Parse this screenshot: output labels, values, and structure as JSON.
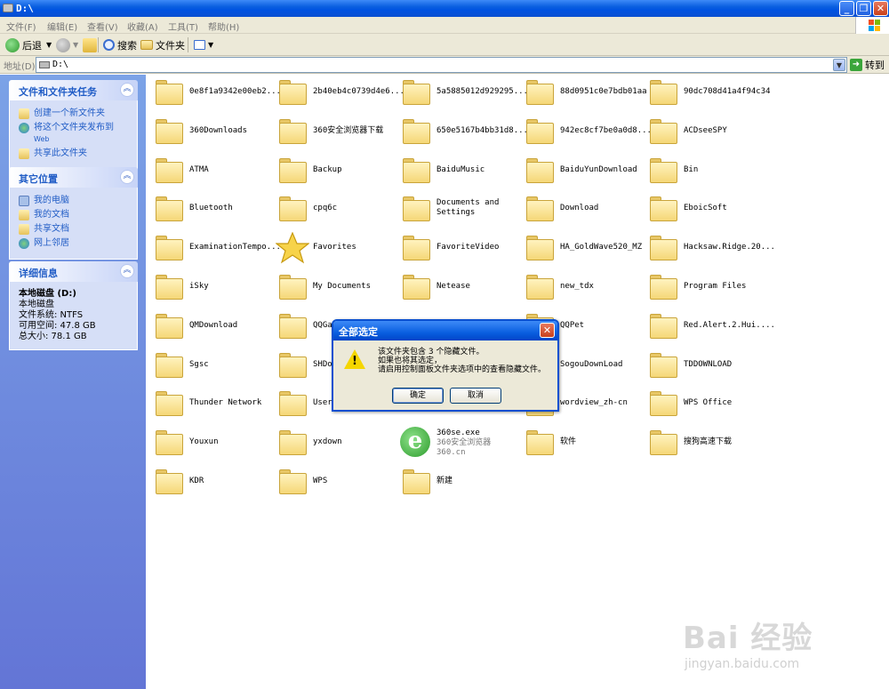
{
  "window": {
    "title": "D:\\"
  },
  "menu": [
    "文件(F)",
    "编辑(E)",
    "查看(V)",
    "收藏(A)",
    "工具(T)",
    "帮助(H)"
  ],
  "toolbar": {
    "back": "后退",
    "search": "搜索",
    "folders": "文件夹"
  },
  "address": {
    "label": "地址(D)",
    "value": "D:\\",
    "go": "转到"
  },
  "side": {
    "tasks": {
      "title": "文件和文件夹任务",
      "links": [
        "创建一个新文件夹",
        "将这个文件夹发布到",
        "Web",
        "共享此文件夹"
      ]
    },
    "places": {
      "title": "其它位置",
      "links": [
        "我的电脑",
        "我的文档",
        "共享文档",
        "网上邻居"
      ]
    },
    "details": {
      "title": "详细信息",
      "name": "本地磁盘 (D:)",
      "type": "本地磁盘",
      "fs": "文件系统: NTFS",
      "free": "可用空间: 47.8 GB",
      "total": "总大小: 78.1 GB"
    }
  },
  "files": [
    [
      "0e8f1a9342e00eb2...",
      "2b40eb4c0739d4e6...",
      "5a5885012d929295...",
      "88d0951c0e7bdb01aa",
      "90dc708d41a4f94c34"
    ],
    [
      "360Downloads",
      "360安全浏览器下载",
      "650e5167b4bb31d8...",
      "942ec8cf7be0a0d8...",
      "ACDseeSPY"
    ],
    [
      "ATMA",
      "Backup",
      "BaiduMusic",
      "BaiduYunDownload",
      "Bin"
    ],
    [
      "Bluetooth",
      "cpq6c",
      "Documents and Settings",
      "Download",
      "EboicSoft"
    ],
    [
      "ExaminationTempo...",
      "Favorites",
      "FavoriteVideo",
      "HA_GoldWave520_MZ",
      "Hacksaw.Ridge.20..."
    ],
    [
      "iSky",
      "My Documents",
      "Netease",
      "new_tdx",
      "Program Files"
    ],
    [
      "QMDownload",
      "QQGame",
      "",
      "QQPet",
      "Red.Alert.2.Hui...."
    ],
    [
      "Sgsc",
      "SHDownload",
      "",
      "SogouDownLoad",
      "TDDOWNLOAD"
    ],
    [
      "Thunder Network",
      "Users",
      "",
      "wordview_zh-cn",
      "WPS Office"
    ],
    [
      "Youxun",
      "yxdown",
      "360se.exe",
      "软件",
      "搜狗高速下载"
    ],
    [
      "KDR",
      "WPS",
      "新建",
      "",
      ""
    ]
  ],
  "exe": {
    "name": "360se.exe",
    "desc": "360安全浏览器",
    "company": "360.cn"
  },
  "dialog": {
    "title": "全部选定",
    "line1": "该文件夹包含 3 个隐藏文件。",
    "line2": "如果也将其选定，",
    "line3": "请启用控制面板文件夹选项中的查看隐藏文件。",
    "ok": "确定",
    "cancel": "取消"
  },
  "watermark": {
    "logo": "Bai 经验",
    "site": "jingyan.baidu.com"
  }
}
